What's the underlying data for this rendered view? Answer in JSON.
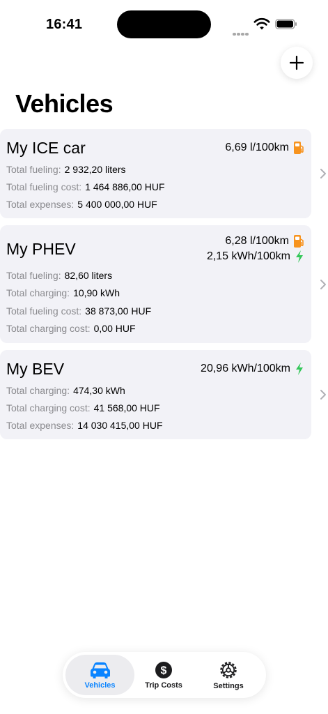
{
  "status": {
    "time": "16:41"
  },
  "header": {
    "title": "Vehicles"
  },
  "colors": {
    "accent": "#0a84ff",
    "fuel": "#f7931e",
    "electric": "#34c759",
    "card": "#f2f2f7"
  },
  "vehicles": [
    {
      "name": "My ICE car",
      "consumption": [
        {
          "value": "6,69 l/100km",
          "icon": "fuel-pump-icon"
        }
      ],
      "stats": [
        {
          "label": "Total fueling:",
          "value": "2 932,20 liters"
        },
        {
          "label": "Total fueling cost:",
          "value": "1 464 886,00 HUF"
        },
        {
          "label": "Total expenses:",
          "value": "5 400 000,00 HUF"
        }
      ]
    },
    {
      "name": "My PHEV",
      "consumption": [
        {
          "value": "6,28 l/100km",
          "icon": "fuel-pump-icon"
        },
        {
          "value": "2,15 kWh/100km",
          "icon": "bolt-icon"
        }
      ],
      "stats": [
        {
          "label": "Total fueling:",
          "value": "82,60 liters"
        },
        {
          "label": "Total charging:",
          "value": "10,90 kWh"
        },
        {
          "label": "Total fueling cost:",
          "value": "38 873,00 HUF"
        },
        {
          "label": "Total charging cost:",
          "value": "0,00 HUF"
        }
      ]
    },
    {
      "name": "My BEV",
      "consumption": [
        {
          "value": "20,96 kWh/100km",
          "icon": "bolt-icon"
        }
      ],
      "stats": [
        {
          "label": "Total charging:",
          "value": "474,30 kWh"
        },
        {
          "label": "Total charging cost:",
          "value": "41 568,00 HUF"
        },
        {
          "label": "Total expenses:",
          "value": "14 030 415,00 HUF"
        }
      ]
    }
  ],
  "tabbar": {
    "selected": "Vehicles",
    "tabs": [
      {
        "label": "Vehicles",
        "icon": "car-icon"
      },
      {
        "label": "Trip Costs",
        "icon": "dollar-circle-icon"
      },
      {
        "label": "Settings",
        "icon": "gear-icon"
      }
    ]
  }
}
